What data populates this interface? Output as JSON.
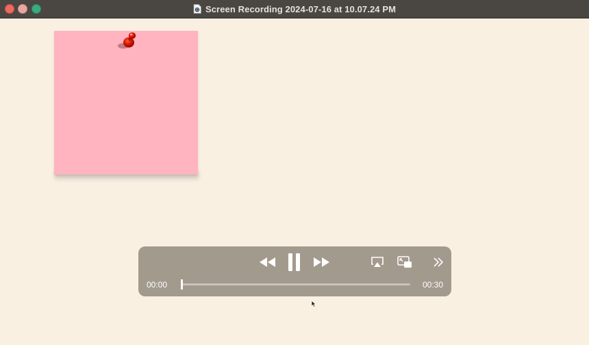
{
  "window": {
    "title": "Screen Recording 2024-07-16 at 10.07.24 PM",
    "title_icon": "recording-file-icon",
    "traffic_lights": [
      "close-button",
      "minimize-button",
      "zoom-button"
    ]
  },
  "content": {
    "background_color": "#FAF0E2",
    "sticky_note": {
      "color": "#FFB4C0",
      "pin": "pushpin-icon",
      "pin_color": "#CC1100"
    }
  },
  "player": {
    "current_time": "00:00",
    "duration": "00:30",
    "progress": 0.0,
    "state": "playing",
    "controls": {
      "rewind": "rewind-icon",
      "play_pause": "pause-icon",
      "fast_forward": "fast-forward-icon",
      "airplay": "airplay-icon",
      "picture_in_picture": "picture-in-picture-icon",
      "more": "chevron-double-right-icon"
    },
    "panel_color": "#A39A8E"
  }
}
